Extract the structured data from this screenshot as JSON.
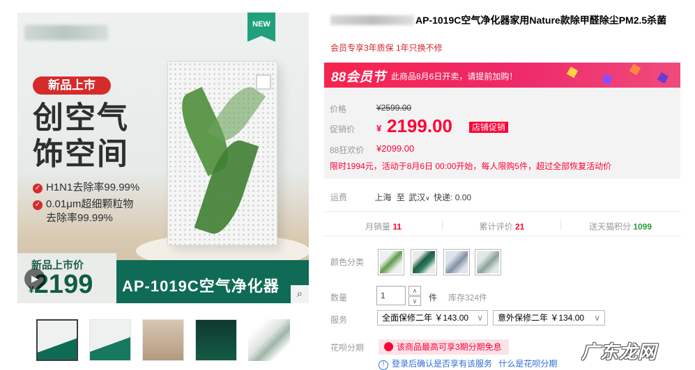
{
  "gallery": {
    "new_tag": "NEW",
    "launch_badge": "新品上市",
    "headline_line1": "创空气",
    "headline_line2": "饰空间",
    "feature1": "H1N1去除率99.99%",
    "feature2_line1": "0.01μm超细颗粒物",
    "feature2_line2": "去除率99.99%",
    "price_label": "新品上市价",
    "price_symbol": "¥",
    "price_value": "2199",
    "model_name": "AP-1019C空气净化器",
    "thumbnails": [
      "thumb-1",
      "thumb-2",
      "thumb-3",
      "thumb-4",
      "thumb-5"
    ]
  },
  "product": {
    "title": "AP-1019C空气净化器家用Nature款除甲醛除尘PM2.5杀菌",
    "subtitle": "会员专享3年质保 1年只换不修"
  },
  "promo": {
    "logo": "88会员节",
    "text": "此商品8月6日开卖，请提前加购！"
  },
  "pricing": {
    "list_label": "价格",
    "list_price": "¥2599.00",
    "sale_label": "促销价",
    "sale_symbol": "¥",
    "sale_price": "2199.00",
    "sale_tag": "店铺促销",
    "vip_label": "88狂欢价",
    "vip_price": "¥2099.00",
    "limit_note": "限时1994元，活动于8月6日 00:00开始，每人限购5件，超过全部恢复活动价"
  },
  "shipping": {
    "label": "运费",
    "from": "上海",
    "to_word": "至",
    "dest": "武汉",
    "fee": "快递: 0.00"
  },
  "stats": {
    "monthly_label": "月销量",
    "monthly_value": "11",
    "reviews_label": "累计评价",
    "reviews_value": "21",
    "points_label": "送天猫积分",
    "points_value": "1099"
  },
  "options": {
    "color_label": "颜色分类",
    "qty_label": "数量",
    "qty_value": "1",
    "qty_unit": "件",
    "stock": "库存324件",
    "service_label": "服务",
    "service1": "全面保修二年 ￥143.00",
    "service2": "意外保修二年 ￥134.00",
    "huabei_label": "花呗分期",
    "huabei_tag": "该商品最高可享3期分期免息",
    "login_note": "登录后确认是否享有该服务",
    "what_link": "什么是花呗分期"
  },
  "watermark": "广东龙网",
  "colors": {
    "accent_red": "#ff0036",
    "brand_green": "#0f6b55",
    "promo_pink": "#f6244e"
  }
}
